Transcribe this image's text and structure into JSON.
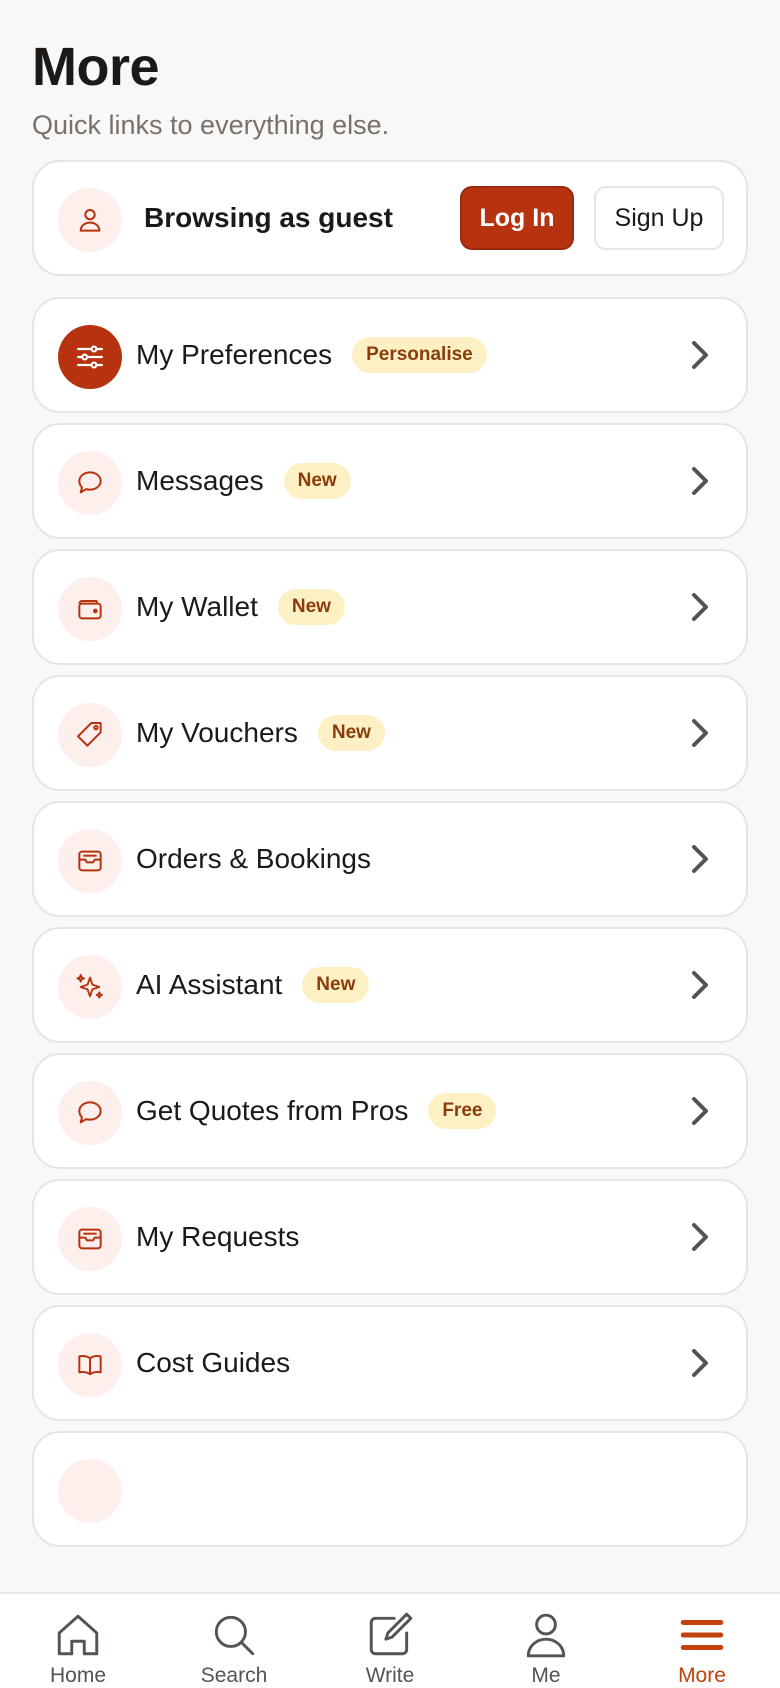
{
  "header": {
    "title": "More",
    "subtitle": "Quick links to everything else."
  },
  "guest": {
    "label": "Browsing as guest",
    "login_label": "Log In",
    "signup_label": "Sign Up",
    "icon": "user-icon"
  },
  "menu": [
    {
      "label": "My Preferences",
      "badge": "Personalise",
      "icon": "sliders-icon"
    },
    {
      "label": "Messages",
      "badge": "New",
      "icon": "chat-bubble-icon"
    },
    {
      "label": "My Wallet",
      "badge": "New",
      "icon": "wallet-icon"
    },
    {
      "label": "My Vouchers",
      "badge": "New",
      "icon": "tag-icon"
    },
    {
      "label": "Orders & Bookings",
      "badge": "",
      "icon": "inbox-icon"
    },
    {
      "label": "AI Assistant",
      "badge": "New",
      "icon": "sparkles-icon"
    },
    {
      "label": "Get Quotes from Pros",
      "badge": "Free",
      "icon": "chat-bubble-icon"
    },
    {
      "label": "My Requests",
      "badge": "",
      "icon": "inbox-icon"
    },
    {
      "label": "Cost Guides",
      "badge": "",
      "icon": "book-open-icon"
    }
  ],
  "tabs": [
    {
      "label": "Home",
      "icon": "home-icon"
    },
    {
      "label": "Search",
      "icon": "search-icon"
    },
    {
      "label": "Write",
      "icon": "edit-icon"
    },
    {
      "label": "Me",
      "icon": "user-icon"
    },
    {
      "label": "More",
      "icon": "menu-icon",
      "active": true
    }
  ],
  "colors": {
    "accent": "#b7330f",
    "badge_bg": "#fdf0c4",
    "badge_text": "#8a3d0a",
    "icon_bg": "#fdf0ec",
    "page_bg": "#f9f8f6"
  }
}
